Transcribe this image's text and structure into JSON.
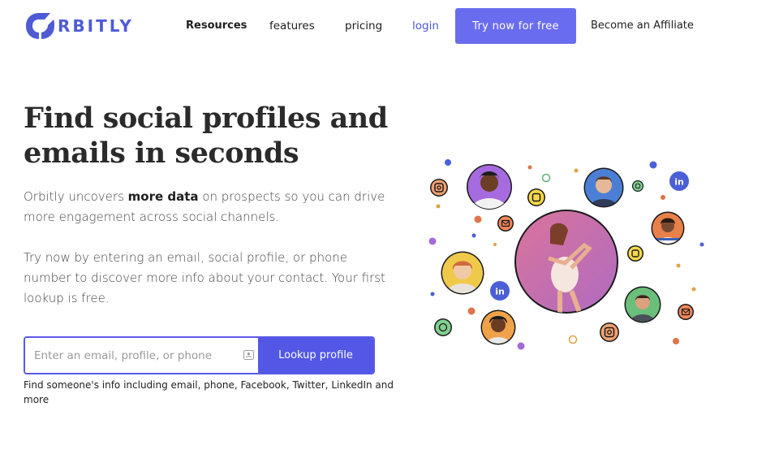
{
  "header": {
    "logo_text": "RBITLY",
    "nav": {
      "resources": "Resources",
      "features": "features",
      "pricing": "pricing",
      "login": "login",
      "try_button": "Try now for free",
      "affiliate": "Become an Affiliate"
    }
  },
  "hero": {
    "title": "Find social profiles and emails in seconds",
    "para1_start": "Orbitly uncovers ",
    "para1_bold": "more data",
    "para1_end": " on prospects so you can drive more engagement across social channels.",
    "para2": "Try now by entering an email, social profile, or phone number to discover more info about your contact. Your first lookup is free.",
    "search": {
      "placeholder": "Enter an email, profile, or phone",
      "value": "",
      "button": "Lookup profile"
    },
    "helper": "Find someone's info including email, phone, Facebook, Twitter, LinkedIn and more"
  },
  "colors": {
    "brand": "#4f5bd5",
    "button": "#6a6cf0",
    "lookup_button": "#5257e6"
  },
  "illustration": {
    "icons": [
      "instagram-icon",
      "linkedin-icon",
      "email-icon",
      "whatsapp-icon",
      "snapchat-icon"
    ]
  }
}
